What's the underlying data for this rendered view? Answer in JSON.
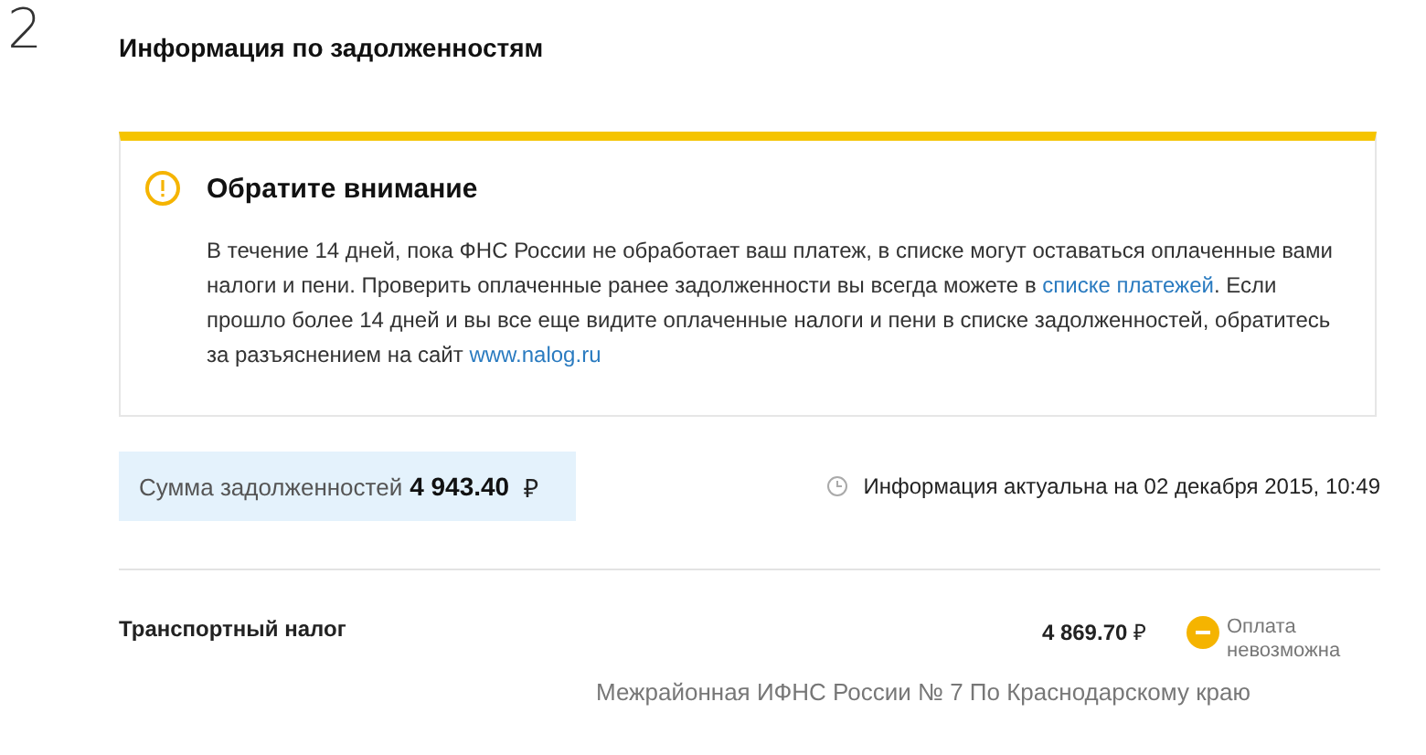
{
  "step": "2",
  "title": "Информация по задолженностям",
  "notice": {
    "heading": "Обратите внимание",
    "text": "В течение 14 дней, пока ФНС России не обработает ваш платеж, в списке могут оставаться оплаченные вами налоги и пени. Проверить оплаченные ранее задолженности вы всегда можете в ",
    "link1": "списке платежей",
    "text2": ".",
    "text3": " Если прошло более 14 дней и вы все еще видите оплаченные налоги и пени в списке задолженностей, обратитесь за разъяснением на сайт ",
    "link2": "www.nalog.ru"
  },
  "summary": {
    "label": "Сумма задолженностей",
    "amount": "4 943.40",
    "currency": "₽",
    "updated": "Информация актуальна на 02 декабря 2015, 10:49"
  },
  "debts": [
    {
      "name": "Транспортный налог",
      "amount": "4 869.70",
      "currency": "₽",
      "status": "Оплата невозможна",
      "payable": false,
      "authority": "Межрайонная ИФНС России № 7 По Краснодарскому краю"
    }
  ]
}
